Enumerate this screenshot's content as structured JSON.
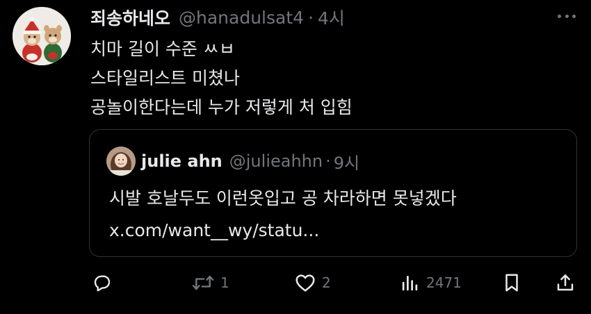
{
  "tweet": {
    "display_name": "죄송하네오",
    "handle": "@hanadulsat4",
    "separator": "·",
    "time": "4시",
    "lines": [
      "치마 길이 수준 ㅆㅂ",
      "스타일리스트 미쳤나",
      "공놀이한다는데 누가 저렇게 처 입힘"
    ],
    "avatar_icon": "plush-toys-avatar",
    "more_icon": "more-dots-icon"
  },
  "quote": {
    "display_name": "julie ahn",
    "handle": "@julieahhn",
    "separator": "·",
    "time": "9시",
    "lines": [
      "시발 호날두도 이런옷입고 공 차라하면 못넣겠다",
      "x.com/want__wy/statu..."
    ],
    "avatar_icon": "user-photo-avatar"
  },
  "actions": {
    "reply": {
      "icon": "reply-icon",
      "count": ""
    },
    "retweet": {
      "icon": "retweet-icon",
      "count": "1"
    },
    "like": {
      "icon": "heart-icon",
      "count": "2"
    },
    "views": {
      "icon": "views-icon",
      "count": "2471"
    },
    "bookmark": {
      "icon": "bookmark-icon",
      "count": ""
    },
    "share": {
      "icon": "share-icon",
      "count": ""
    }
  },
  "colors": {
    "background": "#000000",
    "primary_text": "#e7e9ea",
    "secondary_text": "#71767b",
    "border": "#2f3336"
  }
}
